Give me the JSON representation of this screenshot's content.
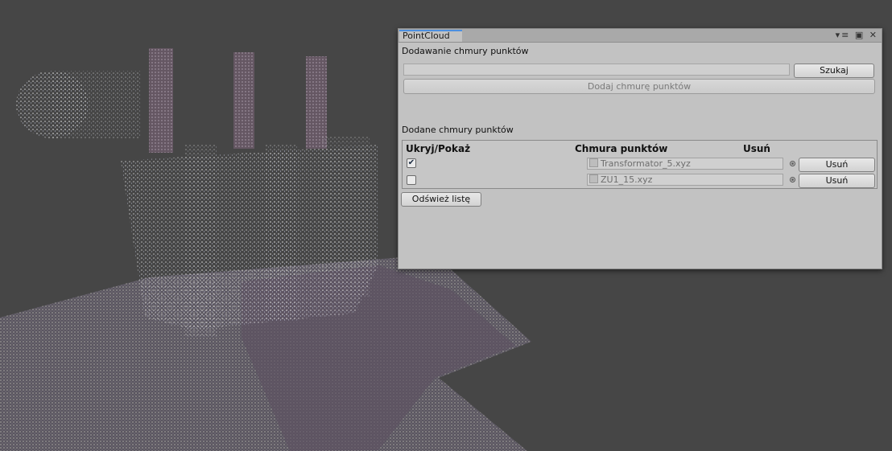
{
  "window": {
    "tab_title": "PointCloud",
    "icons": [
      "menu-icon",
      "maximize-icon",
      "close-icon"
    ]
  },
  "add_section": {
    "title": "Dodawanie chmury punktów",
    "path_value": "",
    "browse_label": "Szukaj",
    "add_label": "Dodaj chmurę punktów"
  },
  "list_section": {
    "title": "Dodane chmury punktów",
    "headers": {
      "toggle": "Ukryj/Pokaż",
      "cloud": "Chmura punktów",
      "remove": "Usuń"
    },
    "rows": [
      {
        "visible": true,
        "file": "Transformator_5.xyz",
        "remove_label": "Usuń"
      },
      {
        "visible": false,
        "file": "ZU1_15.xyz",
        "remove_label": "Usuń"
      }
    ],
    "refresh_label": "Odśwież listę"
  },
  "colors": {
    "background": "#464646",
    "panel": "#c2c2c2",
    "tab_accent": "#4c8fe0"
  }
}
